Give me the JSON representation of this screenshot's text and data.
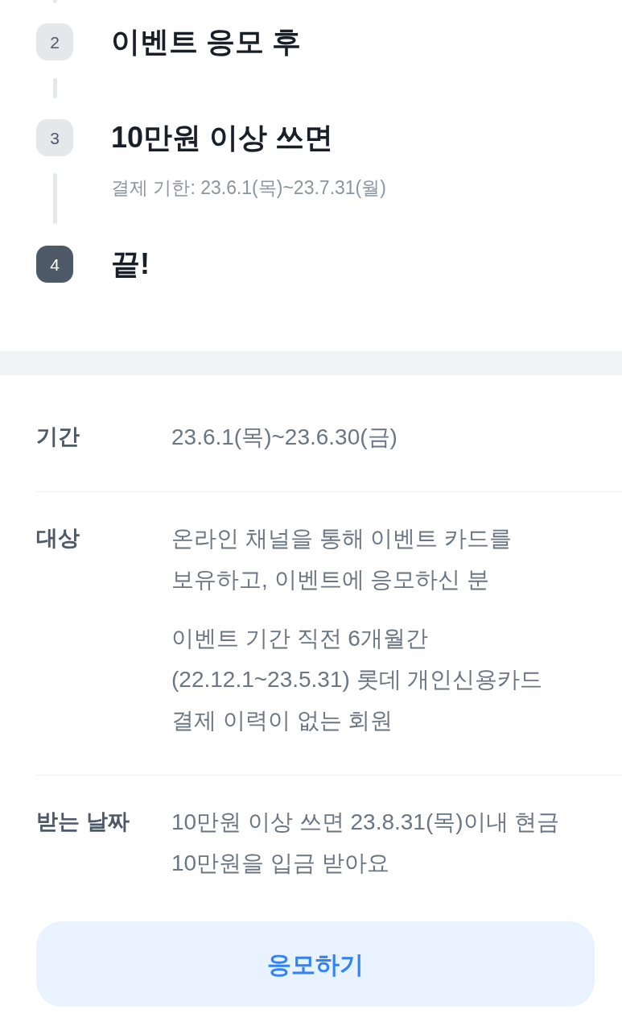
{
  "steps": [
    {
      "number": "2",
      "title": "이벤트 응모 후",
      "selected": false
    },
    {
      "number": "3",
      "title": "10만원 이상 쓰면",
      "note": "결제 기한: 23.6.1(목)~23.7.31(월)",
      "selected": false
    },
    {
      "number": "4",
      "title": "끝!",
      "selected": true
    }
  ],
  "details": [
    {
      "label": "기간",
      "paragraphs": [
        "23.6.1(목)~23.6.30(금)"
      ]
    },
    {
      "label": "대상",
      "paragraphs": [
        "온라인 채널을 통해 이벤트 카드를 보유하고, 이벤트에 응모하신 분",
        "이벤트 기간 직전 6개월간 (22.12.1~23.5.31) 롯데 개인신용카드 결제 이력이 없는 회원"
      ]
    },
    {
      "label": "받는 날짜",
      "paragraphs": [
        "10만원 이상 쓰면 23.8.31(목)이내 현금 10만원을 입금 받아요"
      ]
    }
  ],
  "apply_button": {
    "label": "응모하기"
  }
}
